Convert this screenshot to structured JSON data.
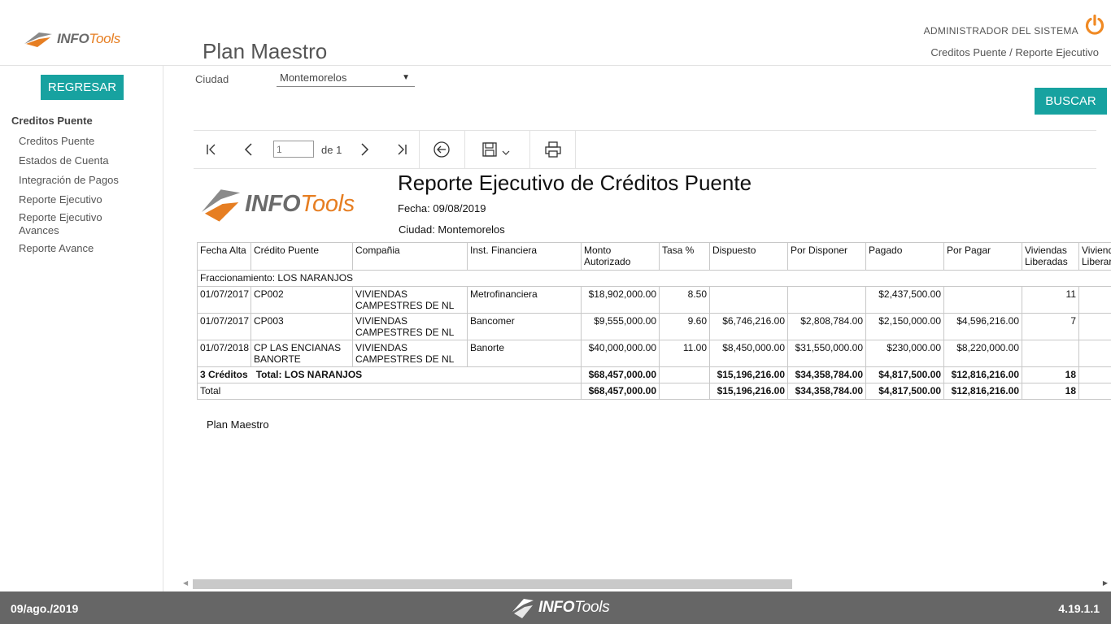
{
  "brand": {
    "name_bold": "INFO",
    "name_light": "Tools"
  },
  "header": {
    "title": "Plan Maestro",
    "user": "ADMINISTRADOR DEL SISTEMA",
    "breadcrumb": "Creditos Puente / Reporte Ejecutivo",
    "accent_color": "#f08a24"
  },
  "sidebar": {
    "back_label": "REGRESAR",
    "section": "Creditos Puente",
    "items": [
      {
        "label": "Creditos Puente"
      },
      {
        "label": "Estados de Cuenta"
      },
      {
        "label": "Integración de Pagos"
      },
      {
        "label": "Reporte Ejecutivo"
      },
      {
        "label": "Reporte Ejecutivo Avances"
      },
      {
        "label": "Reporte Avance"
      }
    ]
  },
  "filter": {
    "city_label": "Ciudad",
    "city_value": "Montemorelos",
    "search_label": "BUSCAR"
  },
  "toolbar": {
    "page_value": "1",
    "page_of": "de 1"
  },
  "report": {
    "title": "Reporte Ejecutivo de Créditos Puente",
    "date": "Fecha: 09/08/2019",
    "city": "Ciudad: Montemorelos",
    "columns": [
      "Fecha Alta",
      "Crédito Puente",
      "Compañia",
      "Inst. Financiera",
      "Monto Autorizado",
      "Tasa %",
      "Dispuesto",
      "Por Disponer",
      "Pagado",
      "Por Pagar",
      "Viviendas Liberadas",
      "Viviendas Por Liberar"
    ],
    "group_label": "Fraccionamiento: LOS NARANJOS",
    "rows": [
      {
        "fecha": "01/07/2017",
        "credito": "CP002",
        "compania": "VIVIENDAS CAMPESTRES DE NL",
        "inst": "Metrofinanciera",
        "monto": "$18,902,000.00",
        "tasa": "8.50",
        "dispuesto": "",
        "por_disponer": "",
        "pagado": "$2,437,500.00",
        "por_pagar": "",
        "liberadas": "11",
        "por_liberar": ""
      },
      {
        "fecha": "01/07/2017",
        "credito": "CP003",
        "compania": "VIVIENDAS CAMPESTRES DE NL",
        "inst": "Bancomer",
        "monto": "$9,555,000.00",
        "tasa": "9.60",
        "dispuesto": "$6,746,216.00",
        "por_disponer": "$2,808,784.00",
        "pagado": "$2,150,000.00",
        "por_pagar": "$4,596,216.00",
        "liberadas": "7",
        "por_liberar": ""
      },
      {
        "fecha": "01/07/2018",
        "credito": "CP LAS ENCIANAS BANORTE",
        "compania": "VIVIENDAS CAMPESTRES DE NL",
        "inst": "Banorte",
        "monto": "$40,000,000.00",
        "tasa": "11.00",
        "dispuesto": "$8,450,000.00",
        "por_disponer": "$31,550,000.00",
        "pagado": "$230,000.00",
        "por_pagar": "$8,220,000.00",
        "liberadas": "",
        "por_liberar": ""
      }
    ],
    "subtotal": {
      "count": "3 Créditos",
      "label": "Total: LOS NARANJOS",
      "monto": "$68,457,000.00",
      "dispuesto": "$15,196,216.00",
      "por_disponer": "$34,358,784.00",
      "pagado": "$4,817,500.00",
      "por_pagar": "$12,816,216.00",
      "liberadas": "18"
    },
    "total": {
      "label": "Total",
      "monto": "$68,457,000.00",
      "dispuesto": "$15,196,216.00",
      "por_disponer": "$34,358,784.00",
      "pagado": "$4,817,500.00",
      "por_pagar": "$12,816,216.00",
      "liberadas": "18"
    },
    "footer_note": "Plan Maestro"
  },
  "footer": {
    "date": "09/ago./2019",
    "version": "4.19.1.1"
  }
}
